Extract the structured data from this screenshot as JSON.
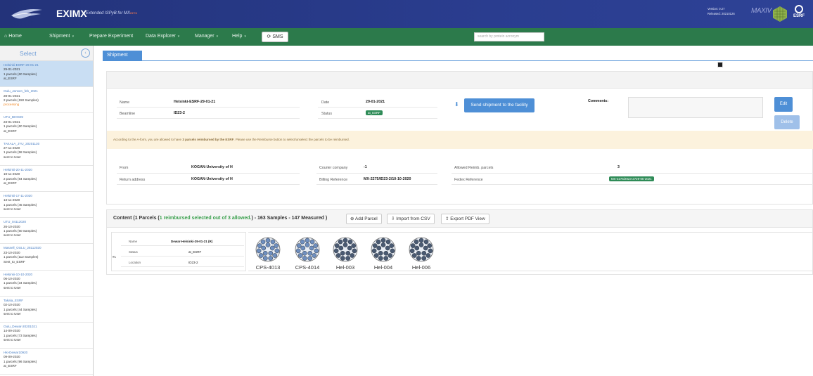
{
  "header": {
    "app_name": "EXIMX",
    "subtitle": "Extended ISPyB for MX",
    "subtitle_tag": "BETA",
    "version": "Version: 0.27",
    "released": "Released: 20210126",
    "partner_logo_text": "MAXIV",
    "esrf_logo_text": "ESRF"
  },
  "nav": {
    "home": "Home",
    "shipment": "Shipment",
    "prepare": "Prepare Experiment",
    "data_explorer": "Data Explorer",
    "manager": "Manager",
    "help": "Help",
    "sms": "SMS",
    "search_placeholder": "search by protein acronym",
    "logout_prefix": "Log out ",
    "user": "MX2275@nurizzo"
  },
  "sidebar": {
    "title": "Select",
    "shipments": [
      {
        "name": "Helsinki-ESRF-29-01-21",
        "date": "29-01-2021",
        "parcels": "1 parcels (60 Samples)",
        "status": "at_ESRF"
      },
      {
        "name": "Oulu_Jansen_feb_2021",
        "date": "28-01-2021",
        "parcels": "2 parcels (150 Samples)",
        "status": "processing"
      },
      {
        "name": "UTU_BIOSIM",
        "date": "23-01-2021",
        "parcels": "1 parcels (60 Samples)",
        "status": "at_ESRF"
      },
      {
        "name": "TAKALA_JYU_20201130",
        "date": "27-11-2020",
        "parcels": "1 parcels (58 Samples)",
        "status": "sent to User"
      },
      {
        "name": "Helsinki-20-11-2020",
        "date": "19-11-2020",
        "parcels": "2 parcels (84 Samples)",
        "status": "at_ESRF"
      },
      {
        "name": "Helsinki-17-11-2020",
        "date": "13-11-2020",
        "parcels": "1 parcels (45 Samples)",
        "status": "sent to User"
      },
      {
        "name": "UTU_04112020",
        "date": "26-10-2020",
        "parcels": "1 parcels (60 Samples)",
        "status": "sent to User"
      },
      {
        "name": "Massell_OULU_28112020",
        "date": "23-10-2020",
        "parcels": "1 parcels (112 Samples)",
        "status": "Sent_to_ESRF"
      },
      {
        "name": "Helsinki-10-10-2020",
        "date": "06-10-2020",
        "parcels": "1 parcels (34 Samples)",
        "status": "sent to User"
      },
      {
        "name": "Takala_ESRF",
        "date": "02-10-2020",
        "parcels": "1 parcels (44 Samples)",
        "status": "sent to User"
      },
      {
        "name": "Oulu_Dewar-20201021",
        "date": "14-09-2020",
        "parcels": "1 parcels (73 Samples)",
        "status": "sent to User"
      },
      {
        "name": "Hki-Dewar10920",
        "date": "09-09-2020",
        "parcels": "1 parcels (96 Samples)",
        "status": "at_ESRF"
      }
    ]
  },
  "tab": {
    "label": "Shipment"
  },
  "shipment": {
    "name_label": "Name",
    "name": "Helsinki-ESRF-29-01-21",
    "beamline_label": "Beamline",
    "beamline": "ID23-2",
    "date_label": "Date",
    "date": "29-01-2021",
    "status_label": "Status",
    "status": "at_ESRF",
    "send_button": "Send shipment to the facility",
    "comments_label": "Comments:",
    "edit": "Edit",
    "delete": "Delete",
    "warning_pre": "According to the A-form, you are allowed to have ",
    "warning_bold": "3 parcels reimbursed by the ESRF",
    "warning_post": ". Please use the Reimburse button to select/unselect the parcels to be reimbursed.",
    "from_label": "From",
    "from": "KOGAN-University of H",
    "return_label": "Return address",
    "return": "KOGAN-University of H",
    "courier_label": "Courier company",
    "courier": "-1",
    "billing_label": "Billing Reference",
    "billing": "MX-2275/ID23-2/10-10-2020",
    "reimb_label": "Allowed Reimb. parcels",
    "reimb": "3",
    "fedex_label": "Fedex Reference",
    "fedex": "MX-2275/2023-2729-05-2021"
  },
  "content": {
    "title_pre": "Content (1 Parcels (",
    "title_green": "1 reimbursed selected out of 3 allowed.",
    "title_post": ") - 163 Samples - 147 Measured )",
    "add_parcel": "Add Parcel",
    "import_csv": "Import from CSV",
    "export_pdf": "Export PDF View",
    "dewar": {
      "index": "#1",
      "name_label": "Name",
      "name": "Dewar-Helsinki-29-01-21 (R)",
      "status_label": "Status",
      "status": "at_ESRF",
      "location_label": "Location",
      "location": "ID23-2"
    },
    "pucks": [
      "CPS-4013",
      "CPS-4014",
      "Hel-003",
      "Hel-004",
      "Hel-006"
    ]
  },
  "colors": {
    "header_bg": "#23337a",
    "nav_bg": "#2c7a4b",
    "accent": "#4e8fd6",
    "warning_bg": "#fcf2dd",
    "status_badge": "#2e8b57",
    "puck_blue": "#6f8fbf",
    "puck_dark": "#4a5a72"
  }
}
